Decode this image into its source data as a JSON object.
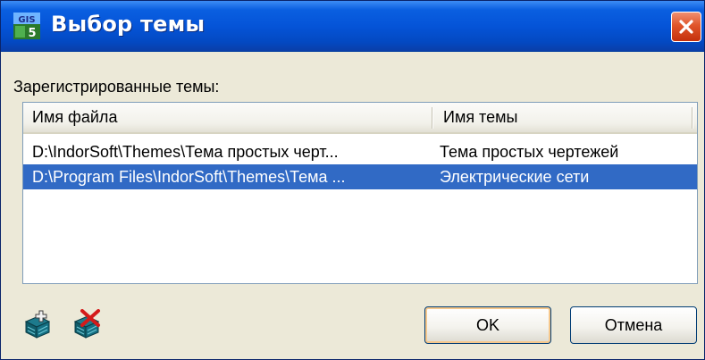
{
  "window": {
    "title": "Выбор темы",
    "app_icon_label": "GIS 5",
    "close_icon": "close-icon"
  },
  "list": {
    "label": "Зарегистрированные темы:",
    "columns": [
      "Имя файла",
      "Имя темы"
    ],
    "rows": [
      {
        "file": "D:\\IndorSoft\\Themes\\Тема простых черт...",
        "theme": "Тема простых чертежей",
        "selected": false
      },
      {
        "file": "D:\\Program Files\\IndorSoft\\Themes\\Тема ...",
        "theme": "Электрические сети",
        "selected": true
      }
    ]
  },
  "toolbar": {
    "icons": [
      "add-theme-icon",
      "remove-theme-icon"
    ]
  },
  "buttons": {
    "ok": "OK",
    "cancel": "Отмена"
  },
  "colors": {
    "titlebar": "#0554d8",
    "selection": "#316ac5",
    "close": "#e0552a",
    "dialog_bg": "#ece9d8"
  }
}
